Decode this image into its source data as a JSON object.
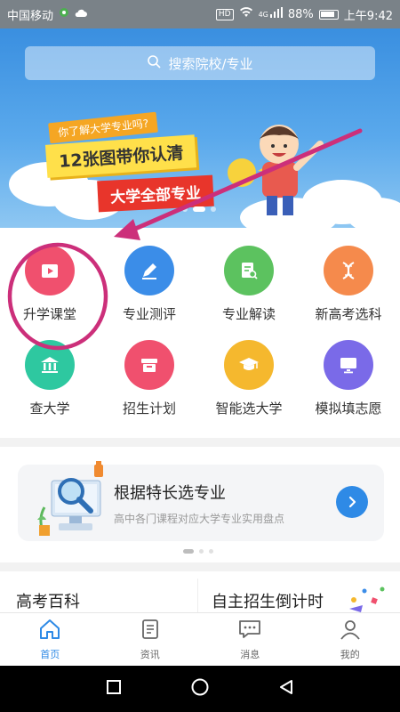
{
  "status_bar": {
    "carrier": "中国移动",
    "battery": "88%",
    "time": "上午9:42",
    "hd": "HD",
    "net": "4G"
  },
  "banner": {
    "search_placeholder": "搜索院校/专业",
    "promo_line1": "你了解大学专业吗?",
    "promo_line2": "12张图带你认清",
    "promo_line3": "大学全部专业"
  },
  "grid": [
    {
      "label": "升学课堂",
      "icon": "video-icon",
      "color": "#f0506e"
    },
    {
      "label": "专业测评",
      "icon": "pencil-icon",
      "color": "#3b8de8"
    },
    {
      "label": "专业解读",
      "icon": "document-search-icon",
      "color": "#5cc25f"
    },
    {
      "label": "新高考选科",
      "icon": "dna-icon",
      "color": "#f58a4c"
    },
    {
      "label": "查大学",
      "icon": "university-icon",
      "color": "#2ec8a0"
    },
    {
      "label": "招生计划",
      "icon": "box-icon",
      "color": "#f0506e"
    },
    {
      "label": "智能选大学",
      "icon": "graduation-cap-icon",
      "color": "#f5b82e"
    },
    {
      "label": "模拟填志愿",
      "icon": "monitor-icon",
      "color": "#7a6ae8"
    }
  ],
  "card": {
    "title": "根据特长选专业",
    "subtitle": "高中各门课程对应大学专业实用盘点"
  },
  "sections": {
    "left": "高考百科",
    "right": "自主招生倒计时"
  },
  "tabbar": [
    {
      "label": "首页",
      "icon": "home-icon",
      "active": true
    },
    {
      "label": "资讯",
      "icon": "news-icon",
      "active": false
    },
    {
      "label": "消息",
      "icon": "message-icon",
      "active": false
    },
    {
      "label": "我的",
      "icon": "profile-icon",
      "active": false
    }
  ],
  "colors": {
    "accent": "#2e8ae6",
    "annotation": "#cc2f7a"
  }
}
